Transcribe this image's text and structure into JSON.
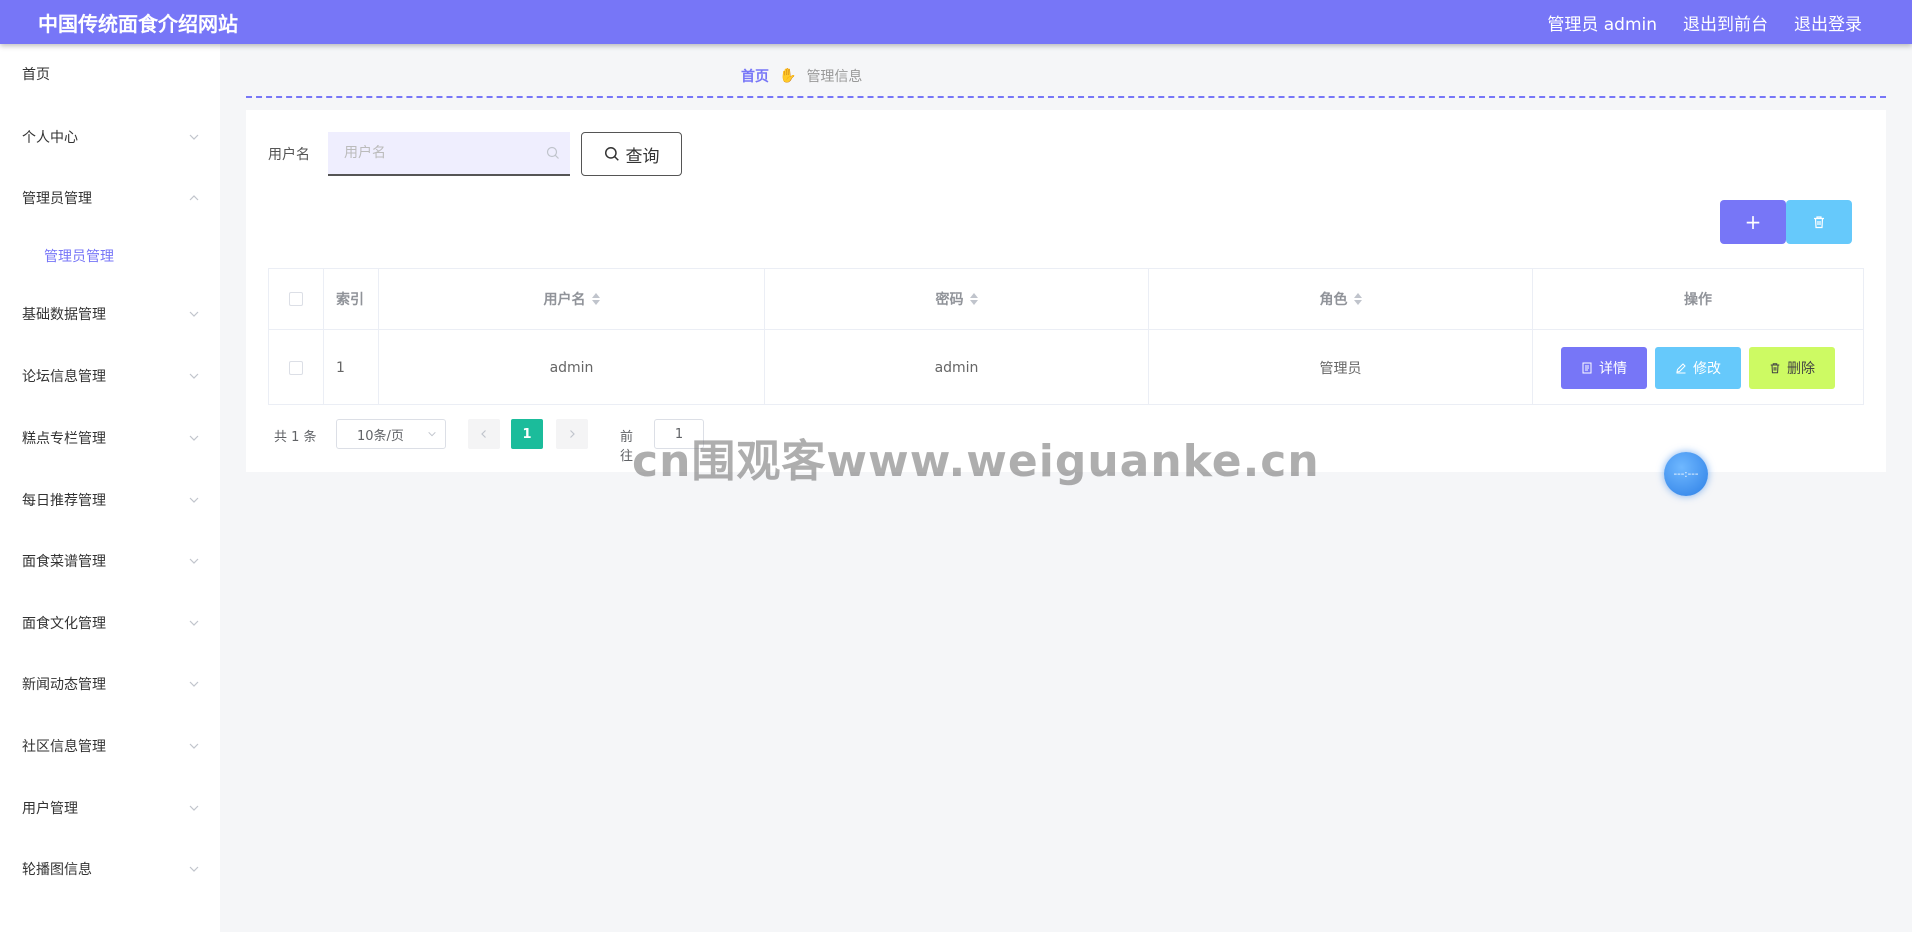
{
  "header": {
    "site_title": "中国传统面食介绍网站",
    "user_label": "管理员 admin",
    "to_front": "退出到前台",
    "logout": "退出登录"
  },
  "sidebar": {
    "items": [
      {
        "label": "首页"
      },
      {
        "label": "个人中心"
      },
      {
        "label": "管理员管理"
      },
      {
        "label": "管理员管理"
      },
      {
        "label": "基础数据管理"
      },
      {
        "label": "论坛信息管理"
      },
      {
        "label": "糕点专栏管理"
      },
      {
        "label": "每日推荐管理"
      },
      {
        "label": "面食菜谱管理"
      },
      {
        "label": "面食文化管理"
      },
      {
        "label": "新闻动态管理"
      },
      {
        "label": "社区信息管理"
      },
      {
        "label": "用户管理"
      },
      {
        "label": "轮播图信息"
      }
    ]
  },
  "breadcrumb": {
    "home": "首页",
    "current": "管理信息"
  },
  "search": {
    "label": "用户名",
    "placeholder": "用户名",
    "value": "",
    "query_label": "查询"
  },
  "actions": {
    "add_label": "+"
  },
  "table": {
    "headers": {
      "index": "索引",
      "username": "用户名",
      "password": "密码",
      "role": "角色",
      "operation": "操作"
    },
    "rows": [
      {
        "index": "1",
        "username": "admin",
        "password": "admin",
        "role": "管理员"
      }
    ],
    "buttons": {
      "detail": "详情",
      "edit": "修改",
      "delete": "删除"
    }
  },
  "pagination": {
    "total": "共 1 条",
    "page_size": "10条/页",
    "current_page": "1",
    "goto_label": "前往",
    "goto_value": "1"
  },
  "watermark": "cn围观客www.weiguanke.cn",
  "float_ball": "---:---"
}
